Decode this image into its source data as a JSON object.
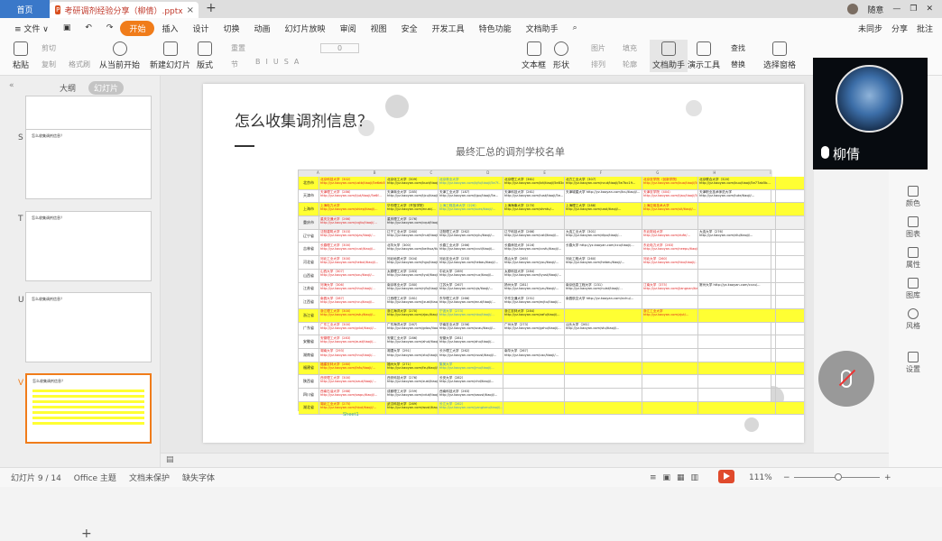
{
  "titlebar": {
    "home_tab": "首页",
    "doc_tab": "考研调剂经验分享（柳倩）.pptx",
    "new_tab": "+",
    "user": "随意"
  },
  "menu": {
    "items": [
      "≡ 文件 ∨",
      "开始",
      "插入",
      "设计",
      "切换",
      "动画",
      "幻灯片放映",
      "审阅",
      "视图",
      "安全",
      "开发工具",
      "特色功能",
      "文档助手"
    ],
    "active": "开始",
    "sync": "未同步",
    "share": "分享",
    "comment": "批注"
  },
  "ribbon": {
    "paste": "粘贴",
    "cut": "剪切",
    "copy": "复制",
    "format_painter": "格式刷",
    "from_current": "从当前开始",
    "new_slide": "新建幻灯片",
    "layout": "版式",
    "section": "节",
    "reset": "重置",
    "font_size": "0",
    "textbox": "文本框",
    "shape": "形状",
    "arrange": "排列",
    "picture": "图片",
    "fill": "填充",
    "outline": "轮廓",
    "doc_helper": "文档助手",
    "presentation_tool": "演示工具",
    "find": "查找",
    "replace": "替换",
    "select_pane": "选择窗格"
  },
  "left_panel": {
    "tab_outline": "大纲",
    "tab_slides": "幻灯片",
    "slide_numbers": [
      "S",
      "T",
      "U",
      "V"
    ],
    "thumb_title": "怎么收集调剂信息？"
  },
  "slide": {
    "title": "怎么收集调剂信息？",
    "subtitle": "最终汇总的调剂学校名单",
    "col_letters": [
      "A",
      "B",
      "C",
      "D",
      "E",
      "F",
      "G",
      "H",
      "I"
    ],
    "rows": [
      {
        "city": "北京市",
        "hl": "y",
        "cells": [
          "北京科技大学（302）http://yz.kaoyan.com/ustb/tiaoji/5e6eb509b4d07.html",
          "北京化工大学（309）http://yz.kaoyan.com/buct/tiaoji/5e736d7e3c0f.html",
          "北京林业大学 http://yz.kaoyan.com/bjfu/tiaoji/5e7f...",
          "北京理工大学（361）http://yz.kaoyan.com/bit/tiaoji/5e83cce4...",
          "北方工业大学（307）http://yz.kaoyan.com/ncut/tiaoji/5e7bc19...",
          "北京农学院（创新学院）http://yz.kaoyan.com/bua/tiaoji/5e...",
          "北京联合大学（320）http://yz.kaoyan.com/buu/tiaoji/5e77ab5b..."
        ]
      },
      {
        "city": "天津市",
        "hl": "",
        "cells": [
          "天津理工大学（286）http://yz.kaoyan.com/tjut/tiaoji/5e6f...",
          "天津商业大学（285）http://yz.kaoyan.com/tjcu/tiaoji/5e6...",
          "天津工业大学（187）http://yz.kaoyan.com/tjpu/tiaoji/5e...",
          "天津科技大学（261）http://yz.kaoyan.com/tust/tiaoji/5e...",
          "天津城建大学 http://yz.kaoyan.com/tcu/tiaoji/...",
          "天津农学院（404）http://yz.kaoyan.com/tjau/tiaoji/5e...",
          "天津职业技术师范大学 http://yz.kaoyan.com/tute/tiaoji/..."
        ]
      },
      {
        "city": "上海市",
        "hl": "y",
        "cells": [
          "上海电力大学 http://yz.kaoyan.com/shiep/tiaoji/...",
          "华东理工大学（开放学院）http://yz.kaoyan.com/ecust/...",
          "上海工程技术大学（226）http://yz.kaoyan.com/sues/tiaoji/...",
          "上海海事大学（270）http://yz.kaoyan.com/shmtu/...",
          "上海理工大学（288）http://yz.kaoyan.com/usst/tiaoji/...",
          "上海应用技术大学 http://yz.kaoyan.com/sit/tiaoji/...",
          ""
        ]
      },
      {
        "city": "重庆市",
        "hl": "g",
        "cells": [
          "重庆交通大学（266）http://yz.kaoyan.com/cqjtu/tiaoji/...",
          "重庆理工大学（276）http://yz.kaoyan.com/cqut/tiaoji/...",
          "",
          "",
          "",
          "",
          ""
        ]
      },
      {
        "city": "辽宁省",
        "hl": "",
        "cells": [
          "沈阳建筑大学（303）http://yz.kaoyan.com/sjzu/tiaoji/...",
          "辽宁工业大学（260）http://yz.kaoyan.com/lnut/tiaoji/...",
          "沈阳理工大学（262）http://yz.kaoyan.com/sylu/tiaoji/...",
          "辽宁科技大学（266）http://yz.kaoyan.com/ustl/tiaoji/...",
          "大连工业大学（301）http://yz.kaoyan.com/dlpu/tiaoji/...",
          "东北财经大学 http://yz.kaoyan.com/dufe/...",
          "大连大学（276）http://yz.kaoyan.com/dlu/tiaoji/..."
        ]
      },
      {
        "city": "吉林省",
        "hl": "",
        "cells": [
          "长春理工大学（300）http://yz.kaoyan.com/cust/tiaoji/...",
          "北华大学（300）http://yz.kaoyan.com/beihua/tiaoji/...",
          "长春工业大学（266）http://yz.kaoyan.com/ccut/tiaoji/...",
          "长春师范大学（416）http://yz.kaoyan.com/ccsfu/tiaoji/...",
          "长春大学 http://yz.kaoyan.com/ccu/tiaoji/...",
          "东北电力大学（263）http://yz.kaoyan.com/neepu/tiaoji/...",
          ""
        ]
      },
      {
        "city": "河北省",
        "hl": "",
        "cells": [
          "河北工业大学（300）http://yz.kaoyan.com/hebut/tiaoji/...",
          "河北地质大学（304）http://yz.kaoyan.com/hgu/tiaoji/...",
          "河北农业大学（253）http://yz.kaoyan.com/hebau/tiaoji/...",
          "燕山大学（265）http://yz.kaoyan.com/ysu/tiaoji/...",
          "河北工程大学（260）http://yz.kaoyan.com/hebeu/tiaoji/...",
          "河北大学（260）http://yz.kaoyan.com/hbu/tiaoji/...",
          ""
        ]
      },
      {
        "city": "山西省",
        "hl": "",
        "cells": [
          "山西大学（307）http://yz.kaoyan.com/sxu/tiaoji/...",
          "太原理工大学（283）http://yz.kaoyan.com/tyut/tiaoji/...",
          "中北大学（289）http://yz.kaoyan.com/nuc/tiaoji/...",
          "太原科技大学（284）http://yz.kaoyan.com/tyust/tiaoji/...",
          "",
          "",
          ""
        ]
      },
      {
        "city": "江苏省",
        "hl": "",
        "cells": [
          "河海大学（306）http://yz.kaoyan.com/hhu/tiaoji/...",
          "南京林业大学（280）http://yz.kaoyan.com/njfu/tiaoji/...",
          "江苏大学（267）http://yz.kaoyan.com/ujs/tiaoji/...",
          "扬州大学（281）http://yz.kaoyan.com/yzu/tiaoji/...",
          "南京信息工程大学（231）http://yz.kaoyan.com/nuist/tiaoji/...",
          "江南大学（375）http://yz.kaoyan.com/jiangnan/tiaoji/...",
          "常州大学 http://yz.kaoyan.com/cczu/..."
        ]
      },
      {
        "city": "江西省",
        "hl": "",
        "cells": [
          "南昌大学（287）http://yz.kaoyan.com/ncu/tiaoji/...",
          "江西理工大学（281）http://yz.kaoyan.com/jxust/tiaoji/...",
          "东华理工大学（266）http://yz.kaoyan.com/ecut/tiaoji/...",
          "华东交通大学（251）http://yz.kaoyan.com/ecjtu/tiaoji/...",
          "南昌航空大学 http://yz.kaoyan.com/nchu/...",
          "",
          ""
        ]
      },
      {
        "city": "浙江省",
        "hl": "y",
        "cells": [
          "浙江理工大学（300）http://yz.kaoyan.com/zstu/tiaoji/...",
          "浙江海洋大学（270）http://yz.kaoyan.com/zjou/tiaoji/...",
          "宁波大学（273）http://yz.kaoyan.com/nbu/tiaoji/...",
          "浙江农林大学（284）http://yz.kaoyan.com/zafu/tiaoji/...",
          "",
          "浙江工业大学 http://yz.kaoyan.com/zjut/...",
          ""
        ]
      },
      {
        "city": "广东省",
        "hl": "",
        "cells": [
          "广东工业大学（300）http://yz.kaoyan.com/gdut/tiaoji/...",
          "广东海洋大学（267）http://yz.kaoyan.com/gdou/tiaoji/...",
          "华南农业大学（256）http://yz.kaoyan.com/scau/tiaoji/...",
          "广州大学（273）http://yz.kaoyan.com/gzhu/tiaoji/...",
          "汕头大学（261）http://yz.kaoyan.com/stu/tiaoji/...",
          "",
          ""
        ]
      },
      {
        "city": "安徽省",
        "hl": "",
        "cells": [
          "安徽理工大学（283）http://yz.kaoyan.com/aust/tiaoji/...",
          "安徽工业大学（286）http://yz.kaoyan.com/ahut/tiaoji/...",
          "安徽大学（281）http://yz.kaoyan.com/ahu/tiaoji/...",
          "",
          "",
          "",
          ""
        ]
      },
      {
        "city": "湖南省",
        "hl": "",
        "cells": [
          "湖南大学（293）http://yz.kaoyan.com/hnu/tiaoji/...",
          "湘潭大学（291）http://yz.kaoyan.com/xtu/tiaoji/...",
          "长沙理工大学（262）http://yz.kaoyan.com/csust/tiaoji/...",
          "南华大学（267）http://yz.kaoyan.com/usc/tiaoji/...",
          "",
          "",
          ""
        ]
      },
      {
        "city": "福建省",
        "hl": "y",
        "cells": [
          "福建农林大学（280）http://yz.kaoyan.com/fafu/tiaoji/...",
          "福州大学（271）http://yz.kaoyan.com/fzu/tiaoji/...",
          "集美大学 http://yz.kaoyan.com/jmu/tiaoji/...",
          "",
          "",
          "",
          ""
        ]
      },
      {
        "city": "陕西省",
        "hl": "",
        "cells": [
          "西安理工大学（300）http://yz.kaoyan.com/xaut/tiaoji/...",
          "西安科技大学（276）http://yz.kaoyan.com/xust/tiaoji/...",
          "长安大学（282）http://yz.kaoyan.com/chd/tiaoji/...",
          "",
          "",
          "",
          ""
        ]
      },
      {
        "city": "四川省",
        "hl": "",
        "cells": [
          "西南石油大学（268）http://yz.kaoyan.com/swpu/tiaoji/...",
          "成都理工大学（259）http://yz.kaoyan.com/cdut/tiaoji/...",
          "西南科技大学（263）http://yz.kaoyan.com/swust/tiaoji/...",
          "",
          "",
          "",
          ""
        ]
      },
      {
        "city": "湖北省",
        "hl": "y",
        "cells": [
          "湖北工业大学（275）http://yz.kaoyan.com/hbut/tiaoji/...",
          "武汉科技大学（269）http://yz.kaoyan.com/wust/tiaoji/...",
          "长江大学（262）http://yz.kaoyan.com/yangtzeu/tiaoji/...",
          "",
          "",
          "",
          ""
        ]
      }
    ],
    "sheet_tab": "Sheet1"
  },
  "right_panel": [
    "颜色",
    "图表",
    "属性",
    "图库",
    "风格",
    "设置"
  ],
  "video": {
    "name": "柳倩"
  },
  "status": {
    "slide": "幻灯片 9 / 14",
    "theme": "Office 主题",
    "protect": "文档未保护",
    "font": "缺失字体",
    "zoom": "111%"
  }
}
